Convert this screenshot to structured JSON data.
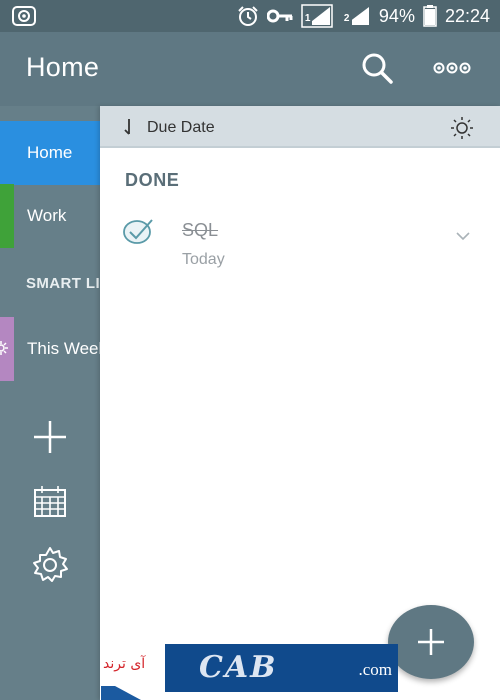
{
  "status_bar": {
    "left_icon": "shield-app-icon",
    "alarm_icon": "alarm-clock-icon",
    "key_icon": "vpn-key-icon",
    "sim1_label": "1",
    "sim2_label": "2",
    "battery_percent": "94%",
    "battery_level": 0.94,
    "time": "22:24"
  },
  "app_bar": {
    "title": "Home",
    "search_icon": "search-icon",
    "more_icon": "more-options-icon"
  },
  "sidebar": {
    "items": [
      {
        "label": "Home",
        "color": "#2a8fe0",
        "selected": true
      },
      {
        "label": "Work",
        "color": "#3fa239"
      },
      {
        "label": "This Week",
        "color": "#b487c1"
      }
    ],
    "smart_lists_heading": "SMART LISTS",
    "actions": [
      "add-list-icon",
      "calendar-icon",
      "settings-icon"
    ]
  },
  "main": {
    "sort_label": "Due Date",
    "sort_icon": "sort-arrow-icon",
    "theme_icon": "brightness-icon",
    "section_title": "DONE",
    "tasks": [
      {
        "title": "SQL",
        "due": "Today",
        "done": true
      }
    ]
  },
  "fab": {
    "icon": "plus-icon"
  },
  "watermark": {
    "persian_text": "آی ترند",
    "letters": "CAB",
    "domain": ".com"
  },
  "colors": {
    "app_bar": "#5f7883",
    "status_bar": "#4f666f",
    "accent_blue": "#2a8fe0",
    "work_green": "#3fa239",
    "week_purple": "#b487c1"
  }
}
